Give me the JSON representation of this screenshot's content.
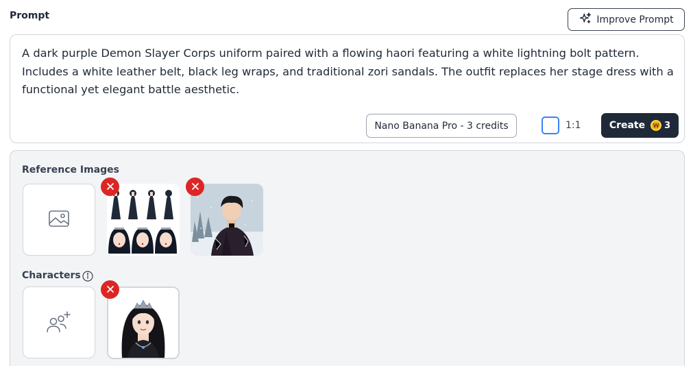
{
  "prompt": {
    "label": "Prompt",
    "text": "A dark purple Demon Slayer Corps uniform paired with a flowing haori featuring a white lightning bolt pattern. Includes a white leather belt, black leg wraps, and traditional zori sandals. The outfit replaces her stage dress with a functional yet elegant battle aesthetic."
  },
  "improve_button": {
    "label": "Improve Prompt",
    "icon": "sparkles-icon"
  },
  "controls": {
    "model": "Nano Banana Pro - 3 credits",
    "aspect_ratio": "1:1",
    "create_label": "Create",
    "create_cost": "3"
  },
  "reference_images": {
    "label": "Reference Images",
    "add_icon": "image-icon",
    "items": [
      {
        "name": "character-sheet-thumbnail"
      },
      {
        "name": "snow-warrior-thumbnail"
      }
    ]
  },
  "characters": {
    "label": "Characters",
    "info_icon": "info-icon",
    "add_icon": "add-user-icon",
    "items": [
      {
        "name": "tiara-girl-thumbnail"
      }
    ]
  },
  "colors": {
    "accent": "#3b82f6",
    "dark": "#1f2937",
    "danger": "#dc2626",
    "coin": "#eab308"
  }
}
